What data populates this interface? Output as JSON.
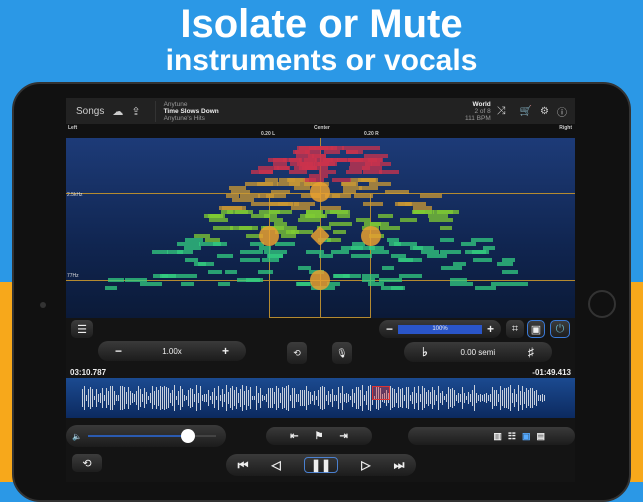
{
  "headline": {
    "line1": "Isolate or Mute",
    "line2": "instruments or vocals"
  },
  "topbar": {
    "songs": "Songs",
    "artist": "Anytune",
    "title": "Time Slows Down",
    "album": "Anytune's Hits",
    "playlist": "World",
    "position": "2 of 8",
    "bpm": "111 BPM"
  },
  "pan": {
    "left": "Left",
    "center": "Center",
    "right": "Right",
    "l_mark": "0.20 L",
    "r_mark": "0.20 R"
  },
  "spectrum": {
    "freq_high": "2.5kHz",
    "freq_low": "77Hz"
  },
  "controls": {
    "speed": "1.00x",
    "volume_pct": "100%",
    "pitch": "0.00 semi",
    "elapsed": "03:10.787",
    "remaining": "-01:49.413",
    "volume_level": 0.78
  }
}
